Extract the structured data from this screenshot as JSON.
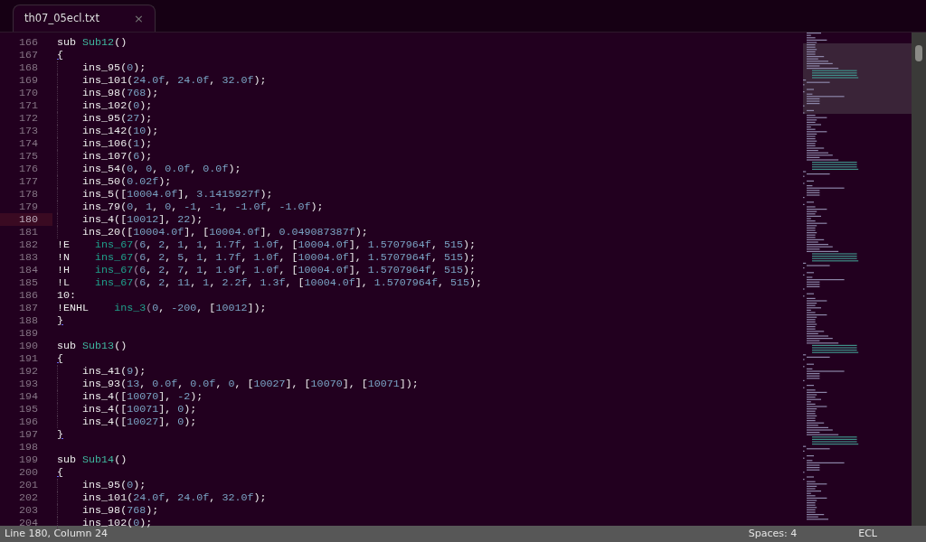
{
  "tabs": [
    {
      "label": "th07_05ecl.txt",
      "close": "×",
      "selected": true
    }
  ],
  "lines": [
    {
      "number": "166",
      "text": "sub Sub12()",
      "current": false
    },
    {
      "number": "167",
      "text": "{",
      "current": false
    },
    {
      "number": "168",
      "text": "    ins_95(0);",
      "current": false
    },
    {
      "number": "169",
      "text": "    ins_101(24.0f, 24.0f, 32.0f);",
      "current": false
    },
    {
      "number": "170",
      "text": "    ins_98(768);",
      "current": false
    },
    {
      "number": "171",
      "text": "    ins_102(0);",
      "current": false
    },
    {
      "number": "172",
      "text": "    ins_95(27);",
      "current": false
    },
    {
      "number": "173",
      "text": "    ins_142(10);",
      "current": false
    },
    {
      "number": "174",
      "text": "    ins_106(1);",
      "current": false
    },
    {
      "number": "175",
      "text": "    ins_107(6);",
      "current": false
    },
    {
      "number": "176",
      "text": "    ins_54(0, 0, 0.0f, 0.0f);",
      "current": false
    },
    {
      "number": "177",
      "text": "    ins_50(0.02f);",
      "current": false
    },
    {
      "number": "178",
      "text": "    ins_5([10004.0f], 3.1415927f);",
      "current": false
    },
    {
      "number": "179",
      "text": "    ins_79(0, 1, 0, -1, -1, -1.0f, -1.0f);",
      "current": false
    },
    {
      "number": "180",
      "text": "    ins_4([10012], 22);",
      "current": true
    },
    {
      "number": "181",
      "text": "    ins_20([10004.0f], [10004.0f], 0.049087387f);",
      "current": false
    },
    {
      "number": "182",
      "text": "!E    ins_67(6, 2, 1, 1, 1.7f, 1.0f, [10004.0f], 1.5707964f, 515);",
      "current": false
    },
    {
      "number": "183",
      "text": "!N    ins_67(6, 2, 5, 1, 1.7f, 1.0f, [10004.0f], 1.5707964f, 515);",
      "current": false
    },
    {
      "number": "184",
      "text": "!H    ins_67(6, 2, 7, 1, 1.9f, 1.0f, [10004.0f], 1.5707964f, 515);",
      "current": false
    },
    {
      "number": "185",
      "text": "!L    ins_67(6, 2, 11, 1, 2.2f, 1.3f, [10004.0f], 1.5707964f, 515);",
      "current": false
    },
    {
      "number": "186",
      "text": "10:",
      "current": false
    },
    {
      "number": "187",
      "text": "!ENHL    ins_3(0, -200, [10012]);",
      "current": false
    },
    {
      "number": "188",
      "text": "}",
      "current": false
    },
    {
      "number": "189",
      "current": false
    },
    {
      "number": "190",
      "text": "sub Sub13()",
      "current": false
    },
    {
      "number": "191",
      "text": "{",
      "current": false
    },
    {
      "number": "192",
      "text": "    ins_41(9);",
      "current": false
    },
    {
      "number": "193",
      "text": "    ins_93(13, 0.0f, 0.0f, 0, [10027], [10070], [10071]);",
      "current": false
    },
    {
      "number": "194",
      "text": "    ins_4([10070], -2);",
      "current": false
    },
    {
      "number": "195",
      "text": "    ins_4([10071], 0);",
      "current": false
    },
    {
      "number": "196",
      "text": "    ins_4([10027], 0);",
      "current": false
    },
    {
      "number": "197",
      "text": "}",
      "current": false
    },
    {
      "number": "198",
      "current": false
    },
    {
      "number": "199",
      "text": "sub Sub14()",
      "current": false
    },
    {
      "number": "200",
      "text": "{",
      "current": false
    },
    {
      "number": "201",
      "text": "    ins_95(0);",
      "current": false
    },
    {
      "number": "202",
      "text": "    ins_101(24.0f, 24.0f, 32.0f);",
      "current": false
    },
    {
      "number": "203",
      "text": "    ins_98(768);",
      "current": false
    },
    {
      "number": "204",
      "text": "    ins_102(0);",
      "current": false
    }
  ],
  "status_bar": {
    "position": "Line 180, Column 24",
    "indentation": "Spaces: 4",
    "syntax": "ECL"
  }
}
